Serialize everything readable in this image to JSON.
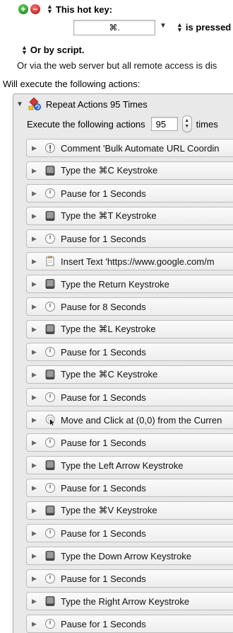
{
  "trigger": {
    "hotkey_label": "This hot key:",
    "hotkey_value": "⌘.",
    "hotkey_condition": "is pressed",
    "script_label": "Or by script.",
    "webserver_text": "Or via the web server but all remote access is dis",
    "will_execute_label": "Will execute the following actions:"
  },
  "repeat": {
    "title": "Repeat Actions 95 Times",
    "execute_prefix": "Execute the following actions",
    "count": "95",
    "times_label": "times"
  },
  "actions": [
    {
      "label": "Comment 'Bulk Automate URL Coordin",
      "icon": "comment-icon"
    },
    {
      "label": "Type the ⌘C Keystroke",
      "icon": "keystroke-icon"
    },
    {
      "label": "Pause for 1 Seconds",
      "icon": "pause-icon"
    },
    {
      "label": "Type the ⌘T Keystroke",
      "icon": "keystroke-icon"
    },
    {
      "label": "Pause for 1 Seconds",
      "icon": "pause-icon"
    },
    {
      "label": "Insert Text 'https://www.google.com/m",
      "icon": "insert-text-icon"
    },
    {
      "label": "Type the Return Keystroke",
      "icon": "keystroke-icon"
    },
    {
      "label": "Pause for 8 Seconds",
      "icon": "pause-icon"
    },
    {
      "label": "Type the ⌘L Keystroke",
      "icon": "keystroke-icon"
    },
    {
      "label": "Pause for 1 Seconds",
      "icon": "pause-icon"
    },
    {
      "label": "Type the ⌘C Keystroke",
      "icon": "keystroke-icon"
    },
    {
      "label": "Pause for 1 Seconds",
      "icon": "pause-icon"
    },
    {
      "label": "Move and Click at (0,0) from the Curren",
      "icon": "mouse-click-icon"
    },
    {
      "label": "Pause for 1 Seconds",
      "icon": "pause-icon"
    },
    {
      "label": "Type the Left Arrow Keystroke",
      "icon": "keystroke-icon"
    },
    {
      "label": "Pause for 1 Seconds",
      "icon": "pause-icon"
    },
    {
      "label": "Type the ⌘V Keystroke",
      "icon": "keystroke-icon"
    },
    {
      "label": "Pause for 1 Seconds",
      "icon": "pause-icon"
    },
    {
      "label": "Type the Down Arrow Keystroke",
      "icon": "keystroke-icon"
    },
    {
      "label": "Pause for 1 Seconds",
      "icon": "pause-icon"
    },
    {
      "label": "Type the Right Arrow Keystroke",
      "icon": "keystroke-icon"
    },
    {
      "label": "Pause for 1 Seconds",
      "icon": "pause-icon"
    }
  ],
  "colors": {
    "add_button": "#2e9e2b",
    "remove_button": "#d92424",
    "container_bg": "#e9e9e9",
    "action_border": "#bdbdbd"
  }
}
